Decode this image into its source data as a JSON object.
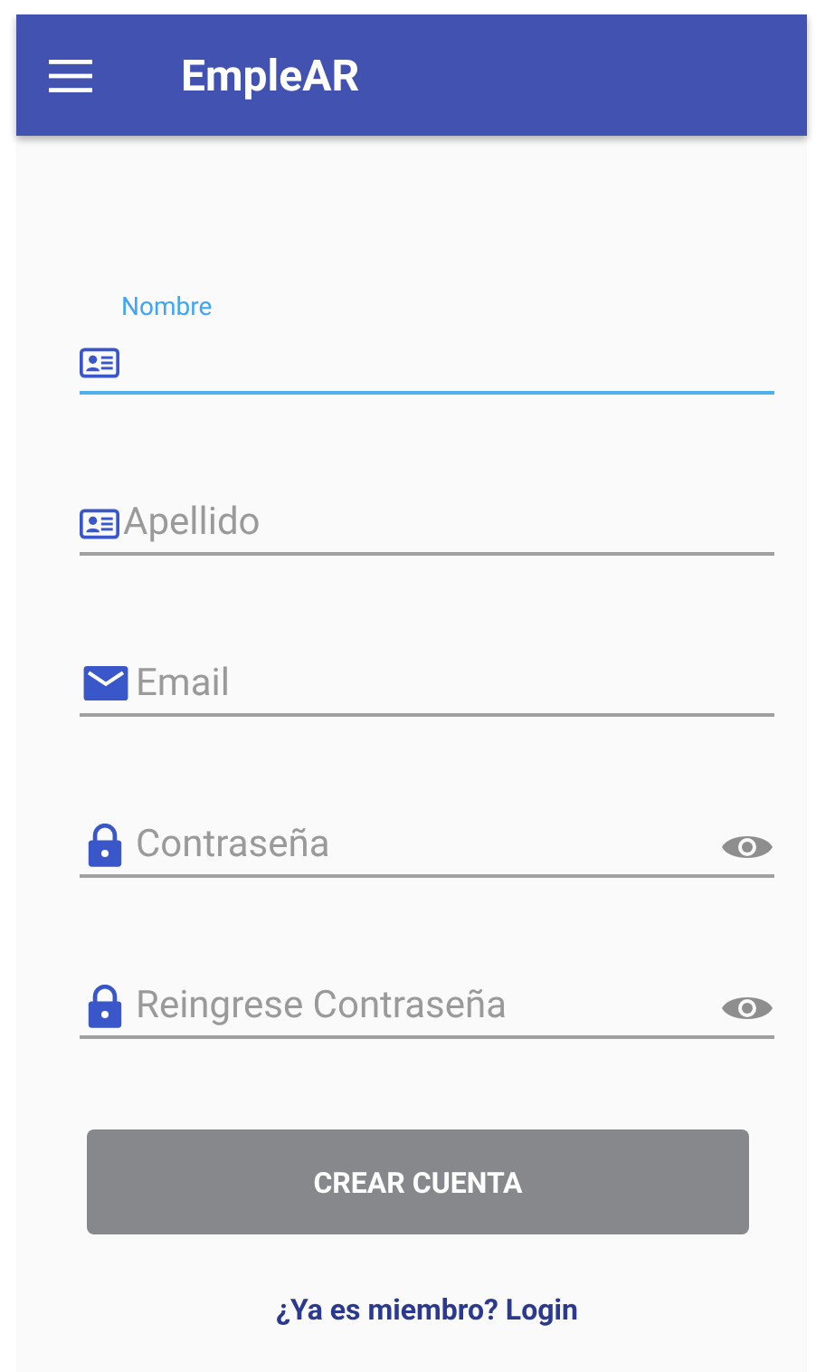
{
  "app_bar": {
    "title": "EmpleAR"
  },
  "fields": [
    {
      "kind": "text",
      "placeholder": "Nombre",
      "focused": true
    },
    {
      "kind": "text",
      "placeholder": "Apellido",
      "focused": false
    },
    {
      "kind": "email",
      "placeholder": "Email",
      "focused": false
    },
    {
      "kind": "password",
      "placeholder": "Contraseña",
      "focused": false
    },
    {
      "kind": "password",
      "placeholder": "Reingrese Contraseña",
      "focused": false
    }
  ],
  "submit_button": {
    "label": "CREAR CUENTA",
    "disabled": true
  },
  "login_link": "¿Ya es miembro? Login"
}
